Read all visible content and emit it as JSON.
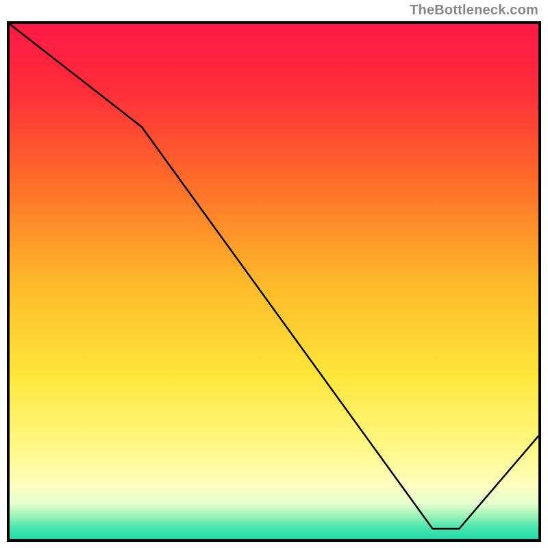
{
  "chart_data": {
    "type": "line",
    "watermark": "TheBottleneck.com",
    "title": "",
    "xlabel": "",
    "ylabel": "",
    "xlim": [
      0,
      100
    ],
    "ylim": [
      0,
      100
    ],
    "grid": false,
    "points": [
      {
        "x": 0,
        "y": 100
      },
      {
        "x": 25,
        "y": 80
      },
      {
        "x": 80,
        "y": 2
      },
      {
        "x": 85,
        "y": 2
      },
      {
        "x": 100,
        "y": 20
      }
    ],
    "label_at_minimum": "",
    "label_position_pct": {
      "x": 76,
      "y": 96.7
    },
    "line_color": "#000000",
    "gradient_stops": [
      {
        "pos": 0.0,
        "color": "#ff1a46"
      },
      {
        "pos": 0.12,
        "color": "#ff2a3a"
      },
      {
        "pos": 0.3,
        "color": "#ff6a2a"
      },
      {
        "pos": 0.5,
        "color": "#ffb82a"
      },
      {
        "pos": 0.68,
        "color": "#ffe63a"
      },
      {
        "pos": 0.82,
        "color": "#fff885"
      },
      {
        "pos": 0.89,
        "color": "#fffdbb"
      },
      {
        "pos": 0.93,
        "color": "#e8ffd0"
      },
      {
        "pos": 0.955,
        "color": "#9cf2b8"
      },
      {
        "pos": 0.975,
        "color": "#52e6b0"
      },
      {
        "pos": 1.0,
        "color": "#1fd9a8"
      }
    ]
  }
}
